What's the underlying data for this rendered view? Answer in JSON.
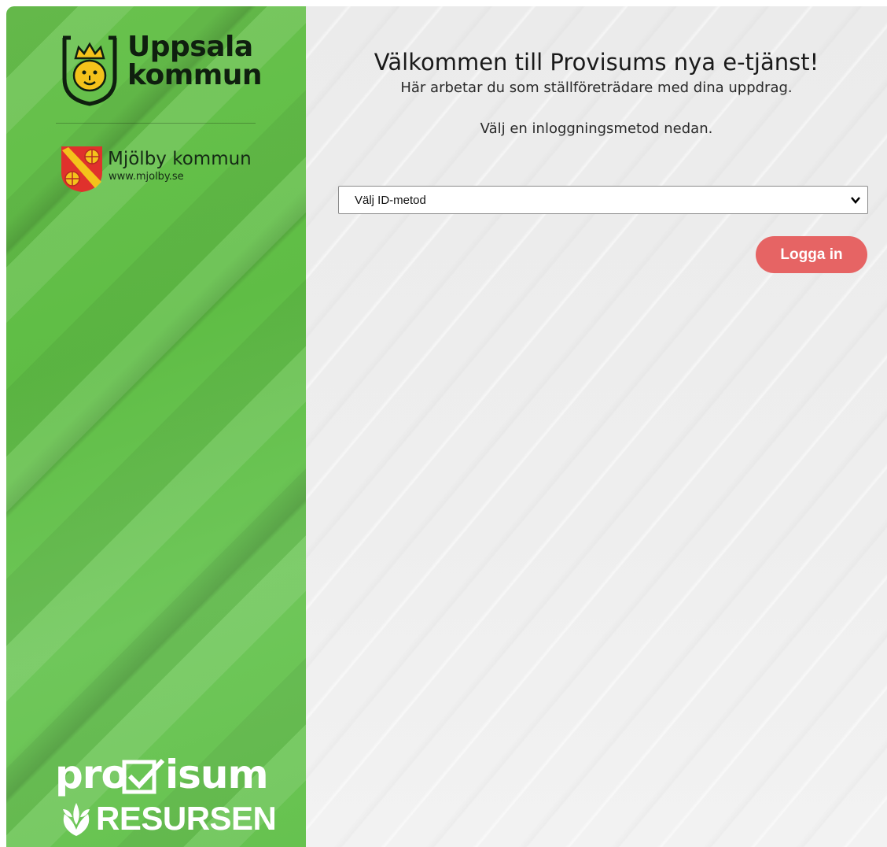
{
  "sidebar": {
    "uppsala": {
      "line1": "Uppsala",
      "line2": "kommun"
    },
    "mjolby": {
      "name": "Mjölby kommun",
      "url": "www.mjolby.se"
    },
    "footer": {
      "pro": "pro",
      "isum": "isum",
      "resursen": "RESURSEN"
    }
  },
  "main": {
    "title": "Välkommen till Provisums nya e-tjänst!",
    "subtitle": "Här arbetar du som ställföreträdare med dina uppdrag.",
    "instruction": "Välj en inloggningsmetod nedan.",
    "id_method": {
      "selected": "Välj ID-metod"
    },
    "login_button": "Logga in"
  },
  "colors": {
    "sidebar_green": "#62bf48",
    "background_gray": "#ececec",
    "login_button": "#e66464"
  },
  "icons": [
    "uppsala-crest-icon",
    "mjolby-crest-icon",
    "chevron-down-icon",
    "checkbox-check-icon",
    "leaf-icon"
  ]
}
